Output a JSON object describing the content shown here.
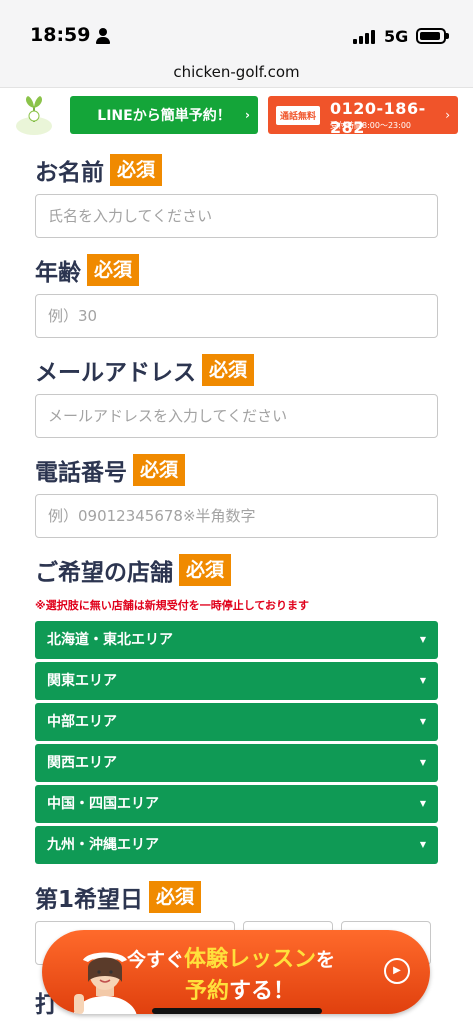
{
  "status": {
    "time": "18:59",
    "network": "5G"
  },
  "browser": {
    "url": "chicken-golf.com"
  },
  "header": {
    "line_button": "LINEから簡単予約！",
    "phone_badge": "通話無料",
    "phone_number": "0120-186-282",
    "phone_hours": "受付時間8:00～23:00",
    "arrow": "›"
  },
  "form": {
    "required": "必須",
    "name": {
      "label": "お名前",
      "placeholder": "氏名を入力してください"
    },
    "age": {
      "label": "年齢",
      "placeholder": "例）30"
    },
    "email": {
      "label": "メールアドレス",
      "placeholder": "メールアドレスを入力してください"
    },
    "phone": {
      "label": "電話番号",
      "placeholder": "例）09012345678※半角数字"
    },
    "store": {
      "label": "ご希望の店舗",
      "notice": "※選択肢に無い店舗は新規受付を一時停止しております",
      "areas": [
        "北海道・東北エリア",
        "関東エリア",
        "中部エリア",
        "関西エリア",
        "中国・四国エリア",
        "九州・沖縄エリア"
      ]
    },
    "first_date": {
      "label": "第1希望日"
    },
    "next_label": "打"
  },
  "cta": {
    "line1_prefix": "今すぐ",
    "line1_highlight": "体験レッスン",
    "line1_suffix": "を",
    "line2_highlight": "予約",
    "line2_suffix": "する！",
    "button_icon": "▶"
  },
  "colors": {
    "line_green": "#14a539",
    "phone_orange": "#f0542a",
    "required_orange": "#f08a00",
    "area_green": "#0f9a55",
    "label_navy": "#2c3550",
    "notice_red": "#e0001b"
  }
}
